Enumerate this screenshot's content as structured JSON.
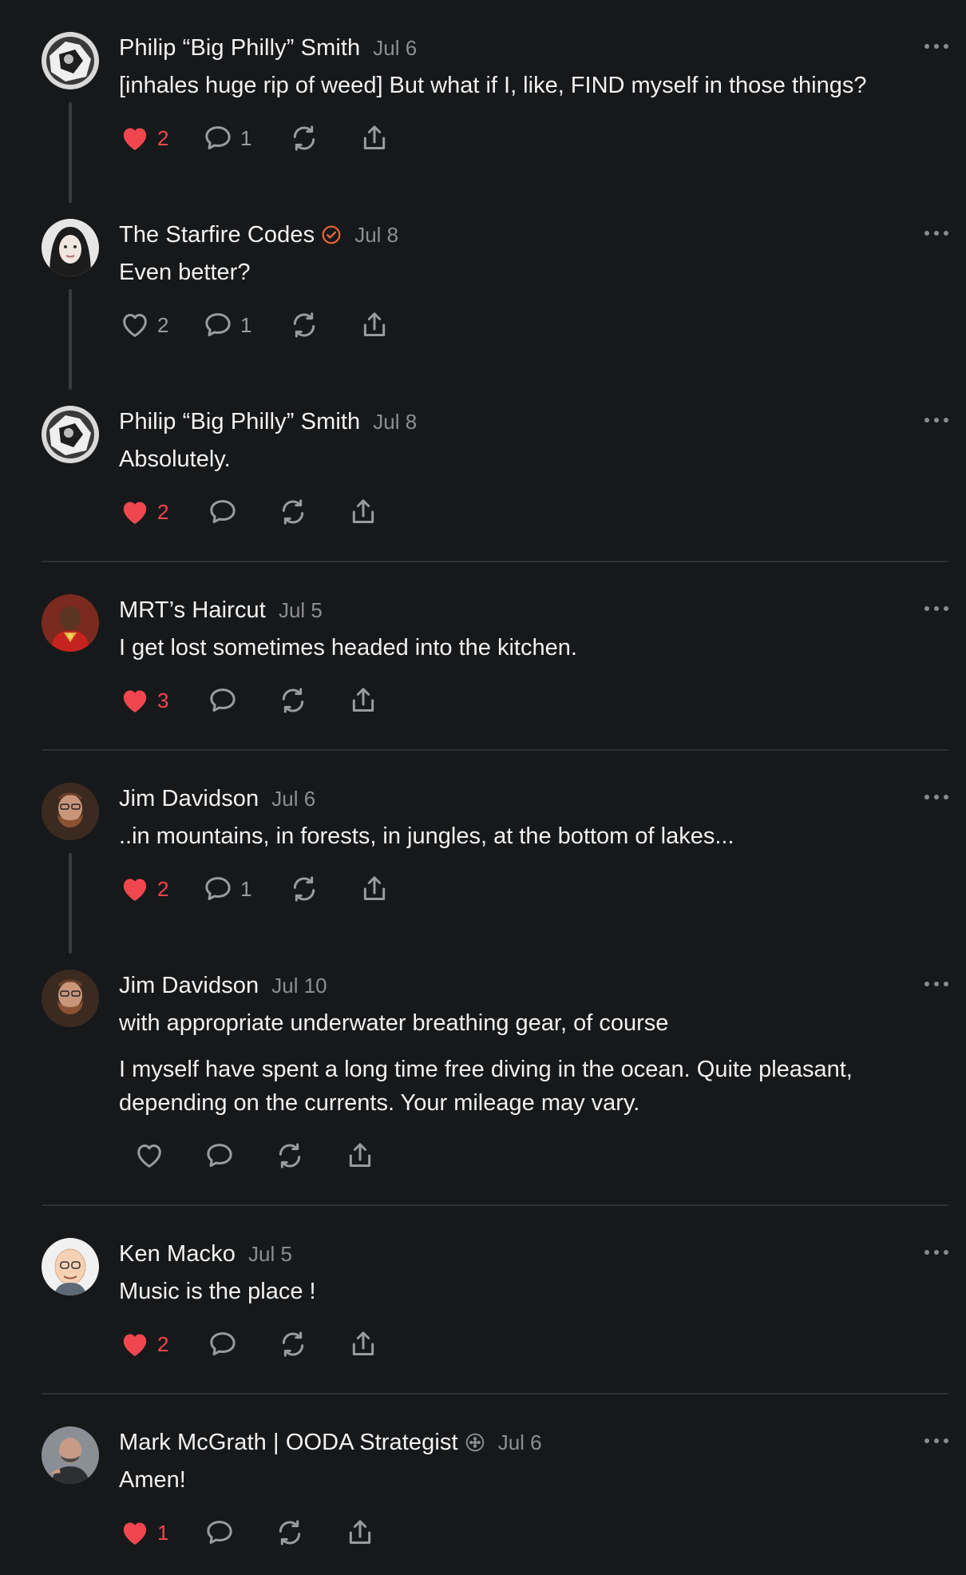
{
  "posts": [
    {
      "author": "Philip “Big Philly” Smith",
      "date": "Jul 6",
      "text": [
        "[inhales huge rip of weed] But what if I, like, FIND myself in those things?"
      ],
      "likes": "2",
      "liked": true,
      "replies": "1"
    },
    {
      "author": "The Starfire Codes",
      "badge": "verified-check-icon",
      "date": "Jul 8",
      "text": [
        "Even better?"
      ],
      "likes": "2",
      "liked": false,
      "replies": "1"
    },
    {
      "author": "Philip “Big Philly” Smith",
      "date": "Jul 8",
      "text": [
        "Absolutely."
      ],
      "likes": "2",
      "liked": true,
      "replies": ""
    },
    {
      "author": "MRT’s Haircut",
      "date": "Jul 5",
      "text": [
        "I get lost sometimes headed into the kitchen."
      ],
      "likes": "3",
      "liked": true,
      "replies": ""
    },
    {
      "author": "Jim Davidson",
      "date": "Jul 6",
      "text": [
        "..in mountains, in forests, in jungles, at the bottom of lakes..."
      ],
      "likes": "2",
      "liked": true,
      "replies": "1"
    },
    {
      "author": "Jim Davidson",
      "date": "Jul 10",
      "text": [
        "with appropriate underwater breathing gear, of course",
        "I myself have spent a long time free diving in the ocean. Quite pleasant, depending on the currents. Your mileage may vary."
      ],
      "likes": "",
      "liked": false,
      "replies": ""
    },
    {
      "author": "Ken Macko",
      "date": "Jul 5",
      "text": [
        "Music is the place !"
      ],
      "likes": "2",
      "liked": true,
      "replies": ""
    },
    {
      "author": "Mark McGrath | OODA Strategist",
      "badge": "flower-badge-icon",
      "date": "Jul 6",
      "text": [
        "Amen!"
      ],
      "likes": "1",
      "liked": true,
      "replies": ""
    }
  ],
  "colors": {
    "background": "#17181a",
    "like_active": "#f0474f",
    "muted": "#9a9b9d",
    "verified_badge": "#e8693a"
  }
}
